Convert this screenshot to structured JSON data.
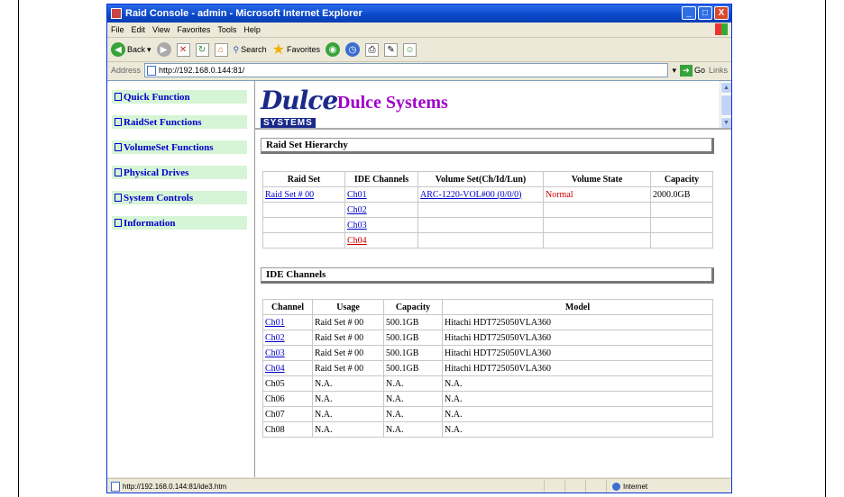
{
  "window": {
    "title": "Raid Console - admin - Microsoft Internet Explorer",
    "buttons": {
      "minimize": "_",
      "maximize": "□",
      "close": "X"
    }
  },
  "menu": [
    "File",
    "Edit",
    "View",
    "Favorites",
    "Tools",
    "Help"
  ],
  "toolbar": {
    "back_label": "Back",
    "search_label": "Search",
    "favorites_label": "Favorites"
  },
  "address": {
    "label": "Address",
    "url": "http://192.168.0.144:81/",
    "go_label": "Go",
    "links_label": "Links"
  },
  "nav": {
    "items": [
      {
        "label": "Quick Function"
      },
      {
        "label": "RaidSet Functions"
      },
      {
        "label": "VolumeSet Functions"
      },
      {
        "label": "Physical Drives"
      },
      {
        "label": "System Controls"
      },
      {
        "label": "Information"
      }
    ]
  },
  "header": {
    "logo_word": "Dulce",
    "logo_sub": "SYSTEMS",
    "brand": "Dulce Systems"
  },
  "raid_hierarchy": {
    "title": "Raid Set Hierarchy",
    "columns": [
      "Raid Set",
      "IDE Channels",
      "Volume Set(Ch/Id/Lun)",
      "Volume State",
      "Capacity"
    ],
    "rows": [
      {
        "raid_set": "Raid Set # 00",
        "channel": "Ch01",
        "volume_set": "ARC-1220-VOL#00 (0/0/0)",
        "state": "Normal",
        "capacity": "2000.0GB"
      },
      {
        "raid_set": "",
        "channel": "Ch02",
        "volume_set": "",
        "state": "",
        "capacity": ""
      },
      {
        "raid_set": "",
        "channel": "Ch03",
        "volume_set": "",
        "state": "",
        "capacity": ""
      },
      {
        "raid_set": "",
        "channel": "Ch04",
        "volume_set": "",
        "state": "",
        "capacity": ""
      }
    ]
  },
  "ide_channels": {
    "title": "IDE Channels",
    "columns": [
      "Channel",
      "Usage",
      "Capacity",
      "Model"
    ],
    "rows": [
      {
        "channel": "Ch01",
        "usage": "Raid Set # 00",
        "capacity": "500.1GB",
        "model": "Hitachi HDT725050VLA360"
      },
      {
        "channel": "Ch02",
        "usage": "Raid Set # 00",
        "capacity": "500.1GB",
        "model": "Hitachi HDT725050VLA360"
      },
      {
        "channel": "Ch03",
        "usage": "Raid Set # 00",
        "capacity": "500.1GB",
        "model": "Hitachi HDT725050VLA360"
      },
      {
        "channel": "Ch04",
        "usage": "Raid Set # 00",
        "capacity": "500.1GB",
        "model": "Hitachi HDT725050VLA360"
      },
      {
        "channel": "Ch05",
        "usage": "N.A.",
        "capacity": "N.A.",
        "model": "N.A."
      },
      {
        "channel": "Ch06",
        "usage": "N.A.",
        "capacity": "N.A.",
        "model": "N.A."
      },
      {
        "channel": "Ch07",
        "usage": "N.A.",
        "capacity": "N.A.",
        "model": "N.A."
      },
      {
        "channel": "Ch08",
        "usage": "N.A.",
        "capacity": "N.A.",
        "model": "N.A."
      }
    ]
  },
  "status": {
    "url": "http://192.168.0.144:81/ide3.htm",
    "zone": "Internet"
  },
  "colors": {
    "nav_bg": "#d6f5d6",
    "nav_text": "#0000cc",
    "brand": "#a000c8",
    "link": "#0000cc",
    "state_normal": "#cc0000"
  }
}
